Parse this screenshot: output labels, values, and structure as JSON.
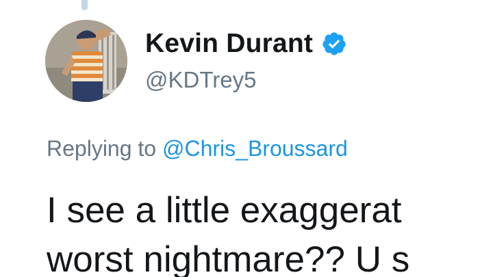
{
  "tweet": {
    "author": {
      "display_name": "Kevin Durant",
      "handle": "@KDTrey5",
      "verified": true,
      "verified_color": "#1da1f2"
    },
    "reply_context": {
      "prefix": "Replying to ",
      "target": "@Chris_Broussard"
    },
    "text_lines": [
      "I see a little exaggerat",
      "worst nightmare?? U s"
    ]
  }
}
